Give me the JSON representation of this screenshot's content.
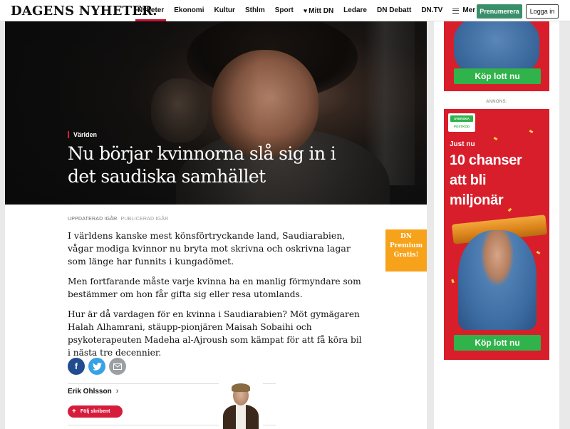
{
  "header": {
    "logo": "DAGENS NYHETER.",
    "nav": [
      {
        "label": "Nyheter",
        "active": true
      },
      {
        "label": "Ekonomi"
      },
      {
        "label": "Kultur"
      },
      {
        "label": "Sthlm"
      },
      {
        "label": "Sport"
      },
      {
        "label": "Mitt DN",
        "icon": "heart-icon"
      },
      {
        "label": "Ledare"
      },
      {
        "label": "DN Debatt"
      },
      {
        "label": "DN.TV"
      }
    ],
    "menu_label": "Mer",
    "subscribe_label": "Prenumerera",
    "login_label": "Logga in"
  },
  "article": {
    "kicker": "Världen",
    "headline": "Nu börjar kvinnorna slå sig in i det saudiska samhället",
    "updated": "UPPDATERAD IGÅR",
    "published": "PUBLICERAD IGÅR",
    "paragraphs": [
      "I världens kanske mest könsförtryckande land, Saudiarabien, vågar modiga kvinnor nu bryta mot skrivna och oskrivna lagar som länge har funnits i kungadömet.",
      "Men fortfarande måste varje kvinna ha en manlig förmyndare som bestämmer om hon får gifta sig eller resa utomlands.",
      "Hur är då vardagen för en kvinna i Saudiarabien? Möt gymägaren Halah Alhamrani, stäupp-pionjären Maisah Sobaihi och psykoterapeuten Madeha al-Ajroush som kämpat för att få köra bil i nästa tre decennier."
    ],
    "premium": [
      "DN",
      "Premium",
      "Gratis!"
    ],
    "share_icons": [
      "facebook-icon",
      "twitter-icon",
      "mail-icon"
    ],
    "author": "Erik Ohlsson",
    "follow_label": "Följ skribent"
  },
  "sidebar": {
    "ad_top_button": "Köp lott nu",
    "ad_label": "ANNONS:",
    "ad_logo_top": "SVENSKA",
    "ad_logo_bottom": "POSTKOD",
    "ad_intro": "Just nu",
    "ad_headline_lines": [
      "10 chanser",
      "att bli",
      "miljonär"
    ],
    "ad_button": "Köp lott nu"
  },
  "colors": {
    "accent_red": "#d61c3b",
    "subscribe_green": "#3a8f6b",
    "ad_red": "#d81e2b",
    "ad_green": "#2fb34a",
    "premium_orange": "#f7a21b"
  }
}
